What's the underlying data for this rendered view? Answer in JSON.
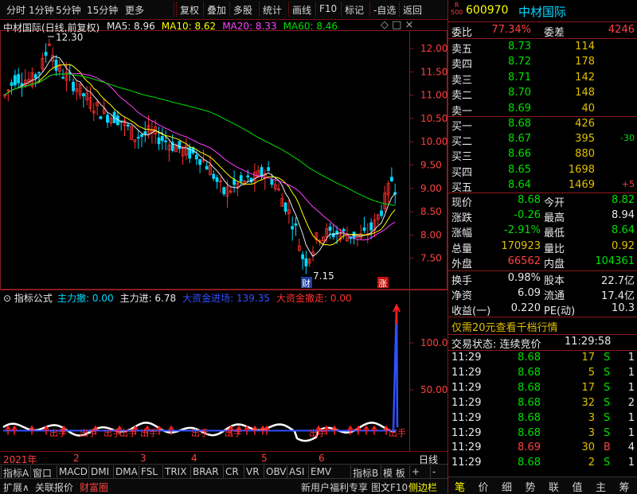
{
  "toolbar": {
    "items": [
      "分时",
      "1分钟",
      "5分钟",
      "15分钟",
      "更多",
      "复权",
      "叠加",
      "多股",
      "统计",
      "画线",
      "F10",
      "标记",
      "-自选",
      "返回"
    ]
  },
  "main_chart": {
    "title": "中材国际(日线,前复权)",
    "ma_labels": [
      {
        "text": "MA5: 8.96",
        "color": "#e8e8e8"
      },
      {
        "text": "MA10: 8.62",
        "color": "#ffff00"
      },
      {
        "text": "MA20: 8.33",
        "color": "#ff40ff"
      },
      {
        "text": "MA60: 8.46",
        "color": "#00e000"
      }
    ],
    "high_label": "12.30",
    "low_label": "7.15",
    "price_ticks": [
      "12.00",
      "11.50",
      "11.00",
      "10.50",
      "10.00",
      "9.50",
      "9.00",
      "8.50",
      "8.00",
      "7.50"
    ],
    "marker_cai": "财",
    "marker_zhang": "涨"
  },
  "indicator": {
    "name": "指标公式",
    "legend": [
      {
        "text": "主力撤: 0.00",
        "color": "#00d8ff"
      },
      {
        "text": "主力进: 6.78",
        "color": "#e8e8e8"
      },
      {
        "text": "大资金进场: 139.35",
        "color": "#3050ff"
      },
      {
        "text": "大资金撤走: 0.00",
        "color": "#ff3030"
      }
    ],
    "ticks": [
      "100.0",
      "50.00"
    ],
    "labels": [
      "出手",
      "出手",
      "出手",
      "出手",
      "出手",
      "出手",
      "出手",
      "出手",
      "出手"
    ]
  },
  "time_axis": {
    "labels": [
      "2021年",
      "2",
      "3",
      "4",
      "5",
      "6"
    ],
    "period": "日线"
  },
  "indicator_tabs": [
    "指标A",
    "窗口",
    "MACD",
    "DMI",
    "DMA",
    "FSL",
    "TRIX",
    "BRAR",
    "CR",
    "VR",
    "OBV",
    "ASI",
    "EMV",
    "指标B",
    "模 板",
    "+",
    "-"
  ],
  "bottom_bar": {
    "left": [
      "扩展∧",
      "关联报价",
      "财富圈"
    ],
    "right": [
      "新用户福利专享",
      "图文F10",
      "侧边栏"
    ]
  },
  "quote": {
    "badge_top": "R",
    "badge_bottom": "500",
    "code": "600970",
    "name": "中材国际",
    "weibi_label": "委比",
    "weibi": "77.34%",
    "weicha_label": "委差",
    "weicha": "4246",
    "sells": [
      {
        "label": "卖五",
        "price": "8.73",
        "vol": "114",
        "chg": ""
      },
      {
        "label": "卖四",
        "price": "8.72",
        "vol": "178",
        "chg": ""
      },
      {
        "label": "卖三",
        "price": "8.71",
        "vol": "142",
        "chg": ""
      },
      {
        "label": "卖二",
        "price": "8.70",
        "vol": "148",
        "chg": ""
      },
      {
        "label": "卖一",
        "price": "8.69",
        "vol": "40",
        "chg": ""
      }
    ],
    "buys": [
      {
        "label": "买一",
        "price": "8.68",
        "vol": "426",
        "chg": ""
      },
      {
        "label": "买二",
        "price": "8.67",
        "vol": "395",
        "chg": "-30"
      },
      {
        "label": "买三",
        "price": "8.66",
        "vol": "880",
        "chg": ""
      },
      {
        "label": "买四",
        "price": "8.65",
        "vol": "1698",
        "chg": ""
      },
      {
        "label": "买五",
        "price": "8.64",
        "vol": "1469",
        "chg": "+5"
      }
    ],
    "stats": [
      {
        "l1": "现价",
        "v1": "8.68",
        "c1": "#00e000",
        "l2": "今开",
        "v2": "8.82",
        "c2": "#00e000"
      },
      {
        "l1": "涨跌",
        "v1": "-0.26",
        "c1": "#00e000",
        "l2": "最高",
        "v2": "8.94",
        "c2": "#e8e8e8"
      },
      {
        "l1": "涨幅",
        "v1": "-2.91%",
        "c1": "#00e000",
        "l2": "最低",
        "v2": "8.64",
        "c2": "#00e000"
      },
      {
        "l1": "总量",
        "v1": "170923",
        "c1": "#e0c000",
        "l2": "量比",
        "v2": "0.92",
        "c2": "#e0c000"
      },
      {
        "l1": "外盘",
        "v1": "66562",
        "c1": "#ff4040",
        "l2": "内盘",
        "v2": "104361",
        "c2": "#00e000"
      }
    ],
    "stats2": [
      {
        "l1": "换手",
        "v1": "0.98%",
        "l2": "股本",
        "v2": "22.7亿"
      },
      {
        "l1": "净资",
        "v1": "6.09",
        "l2": "流通",
        "v2": "17.4亿"
      },
      {
        "l1": "收益(一)",
        "v1": "0.220",
        "l2": "PE(动)",
        "v2": "10.3"
      }
    ],
    "promo": "仅需20元查看千档行情",
    "trade_status": "交易状态: 连续竞价",
    "trade_time": "11:29:58",
    "ticks": [
      {
        "t": "11:29",
        "p": "8.68",
        "v": "17",
        "bs": "S",
        "n": "1"
      },
      {
        "t": "11:29",
        "p": "8.68",
        "v": "5",
        "bs": "S",
        "n": "1"
      },
      {
        "t": "11:29",
        "p": "8.68",
        "v": "17",
        "bs": "S",
        "n": "1"
      },
      {
        "t": "11:29",
        "p": "8.68",
        "v": "32",
        "bs": "S",
        "n": "2"
      },
      {
        "t": "11:29",
        "p": "8.68",
        "v": "3",
        "bs": "S",
        "n": "1"
      },
      {
        "t": "11:29",
        "p": "8.68",
        "v": "3",
        "bs": "S",
        "n": "1"
      },
      {
        "t": "11:29",
        "p": "8.69",
        "v": "30",
        "bs": "B",
        "n": "4"
      },
      {
        "t": "11:29",
        "p": "8.68",
        "v": "2",
        "bs": "S",
        "n": "1"
      }
    ],
    "bottom_tabs": [
      "笔",
      "价",
      "细",
      "势",
      "联",
      "值",
      "主",
      "筹"
    ]
  }
}
